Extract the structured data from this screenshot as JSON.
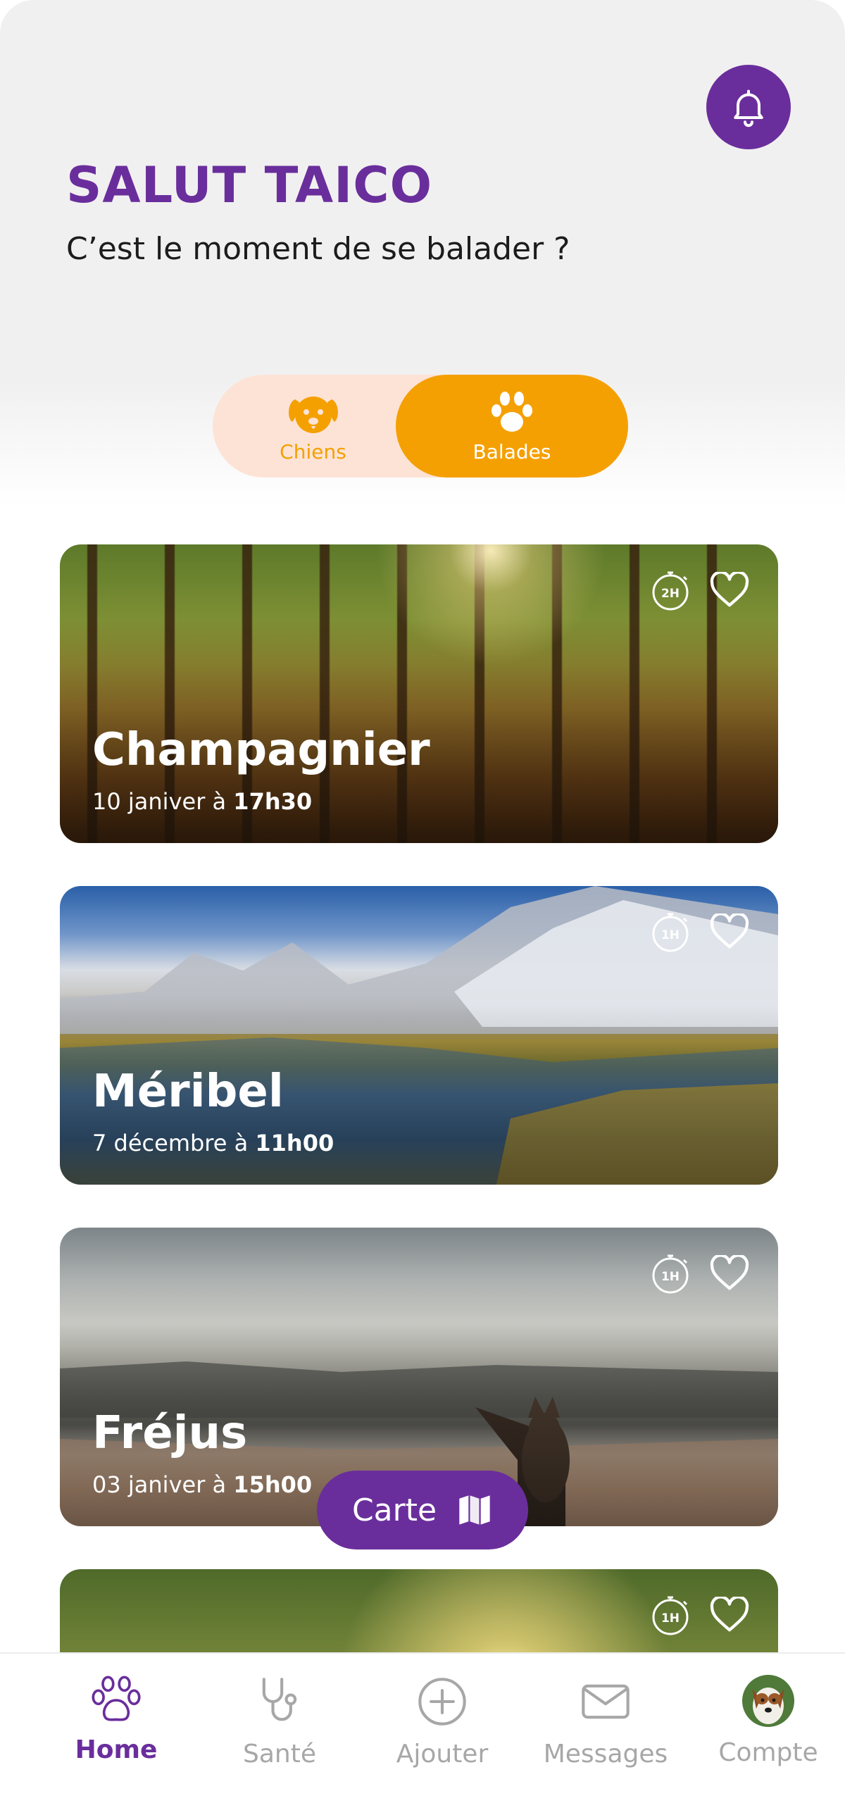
{
  "header": {
    "title": "SALUT TAICO",
    "subtitle": "C’est le moment de se balader ?"
  },
  "toggle": {
    "items": [
      {
        "label": "Chiens",
        "icon": "dog-face-icon",
        "active": false
      },
      {
        "label": "Balades",
        "icon": "paw-icon",
        "active": true
      }
    ]
  },
  "walks": [
    {
      "name": "Champagnier",
      "date": "10 janiver à ",
      "time": "17h30",
      "duration": "2H",
      "scene": "autumn-forest"
    },
    {
      "name": "Méribel",
      "date": "7 décembre à ",
      "time": "11h00",
      "duration": "1H",
      "scene": "mountain-lake"
    },
    {
      "name": "Fréjus",
      "date": "03 janiver à ",
      "time": "15h00",
      "duration": "1H",
      "scene": "beach-with-dog"
    },
    {
      "name": "",
      "date": "",
      "time": "",
      "duration": "1H",
      "scene": "sunlit-forest"
    }
  ],
  "map_button": {
    "label": "Carte",
    "icon": "map-icon"
  },
  "tabbar": {
    "tabs": [
      {
        "label": "Home",
        "icon": "paw-icon",
        "active": true
      },
      {
        "label": "Santé",
        "icon": "stethoscope-icon",
        "active": false
      },
      {
        "label": "Ajouter",
        "icon": "plus-circle-icon",
        "active": false
      },
      {
        "label": "Messages",
        "icon": "envelope-icon",
        "active": false
      },
      {
        "label": "Compte",
        "icon": "avatar-icon",
        "active": false
      }
    ]
  },
  "colors": {
    "primary": "#6a2e9c",
    "accent": "#f5a002",
    "toggle_bg": "#fde3d6",
    "header_bg": "#f1f0f1",
    "inactive": "#a7a7a7"
  }
}
